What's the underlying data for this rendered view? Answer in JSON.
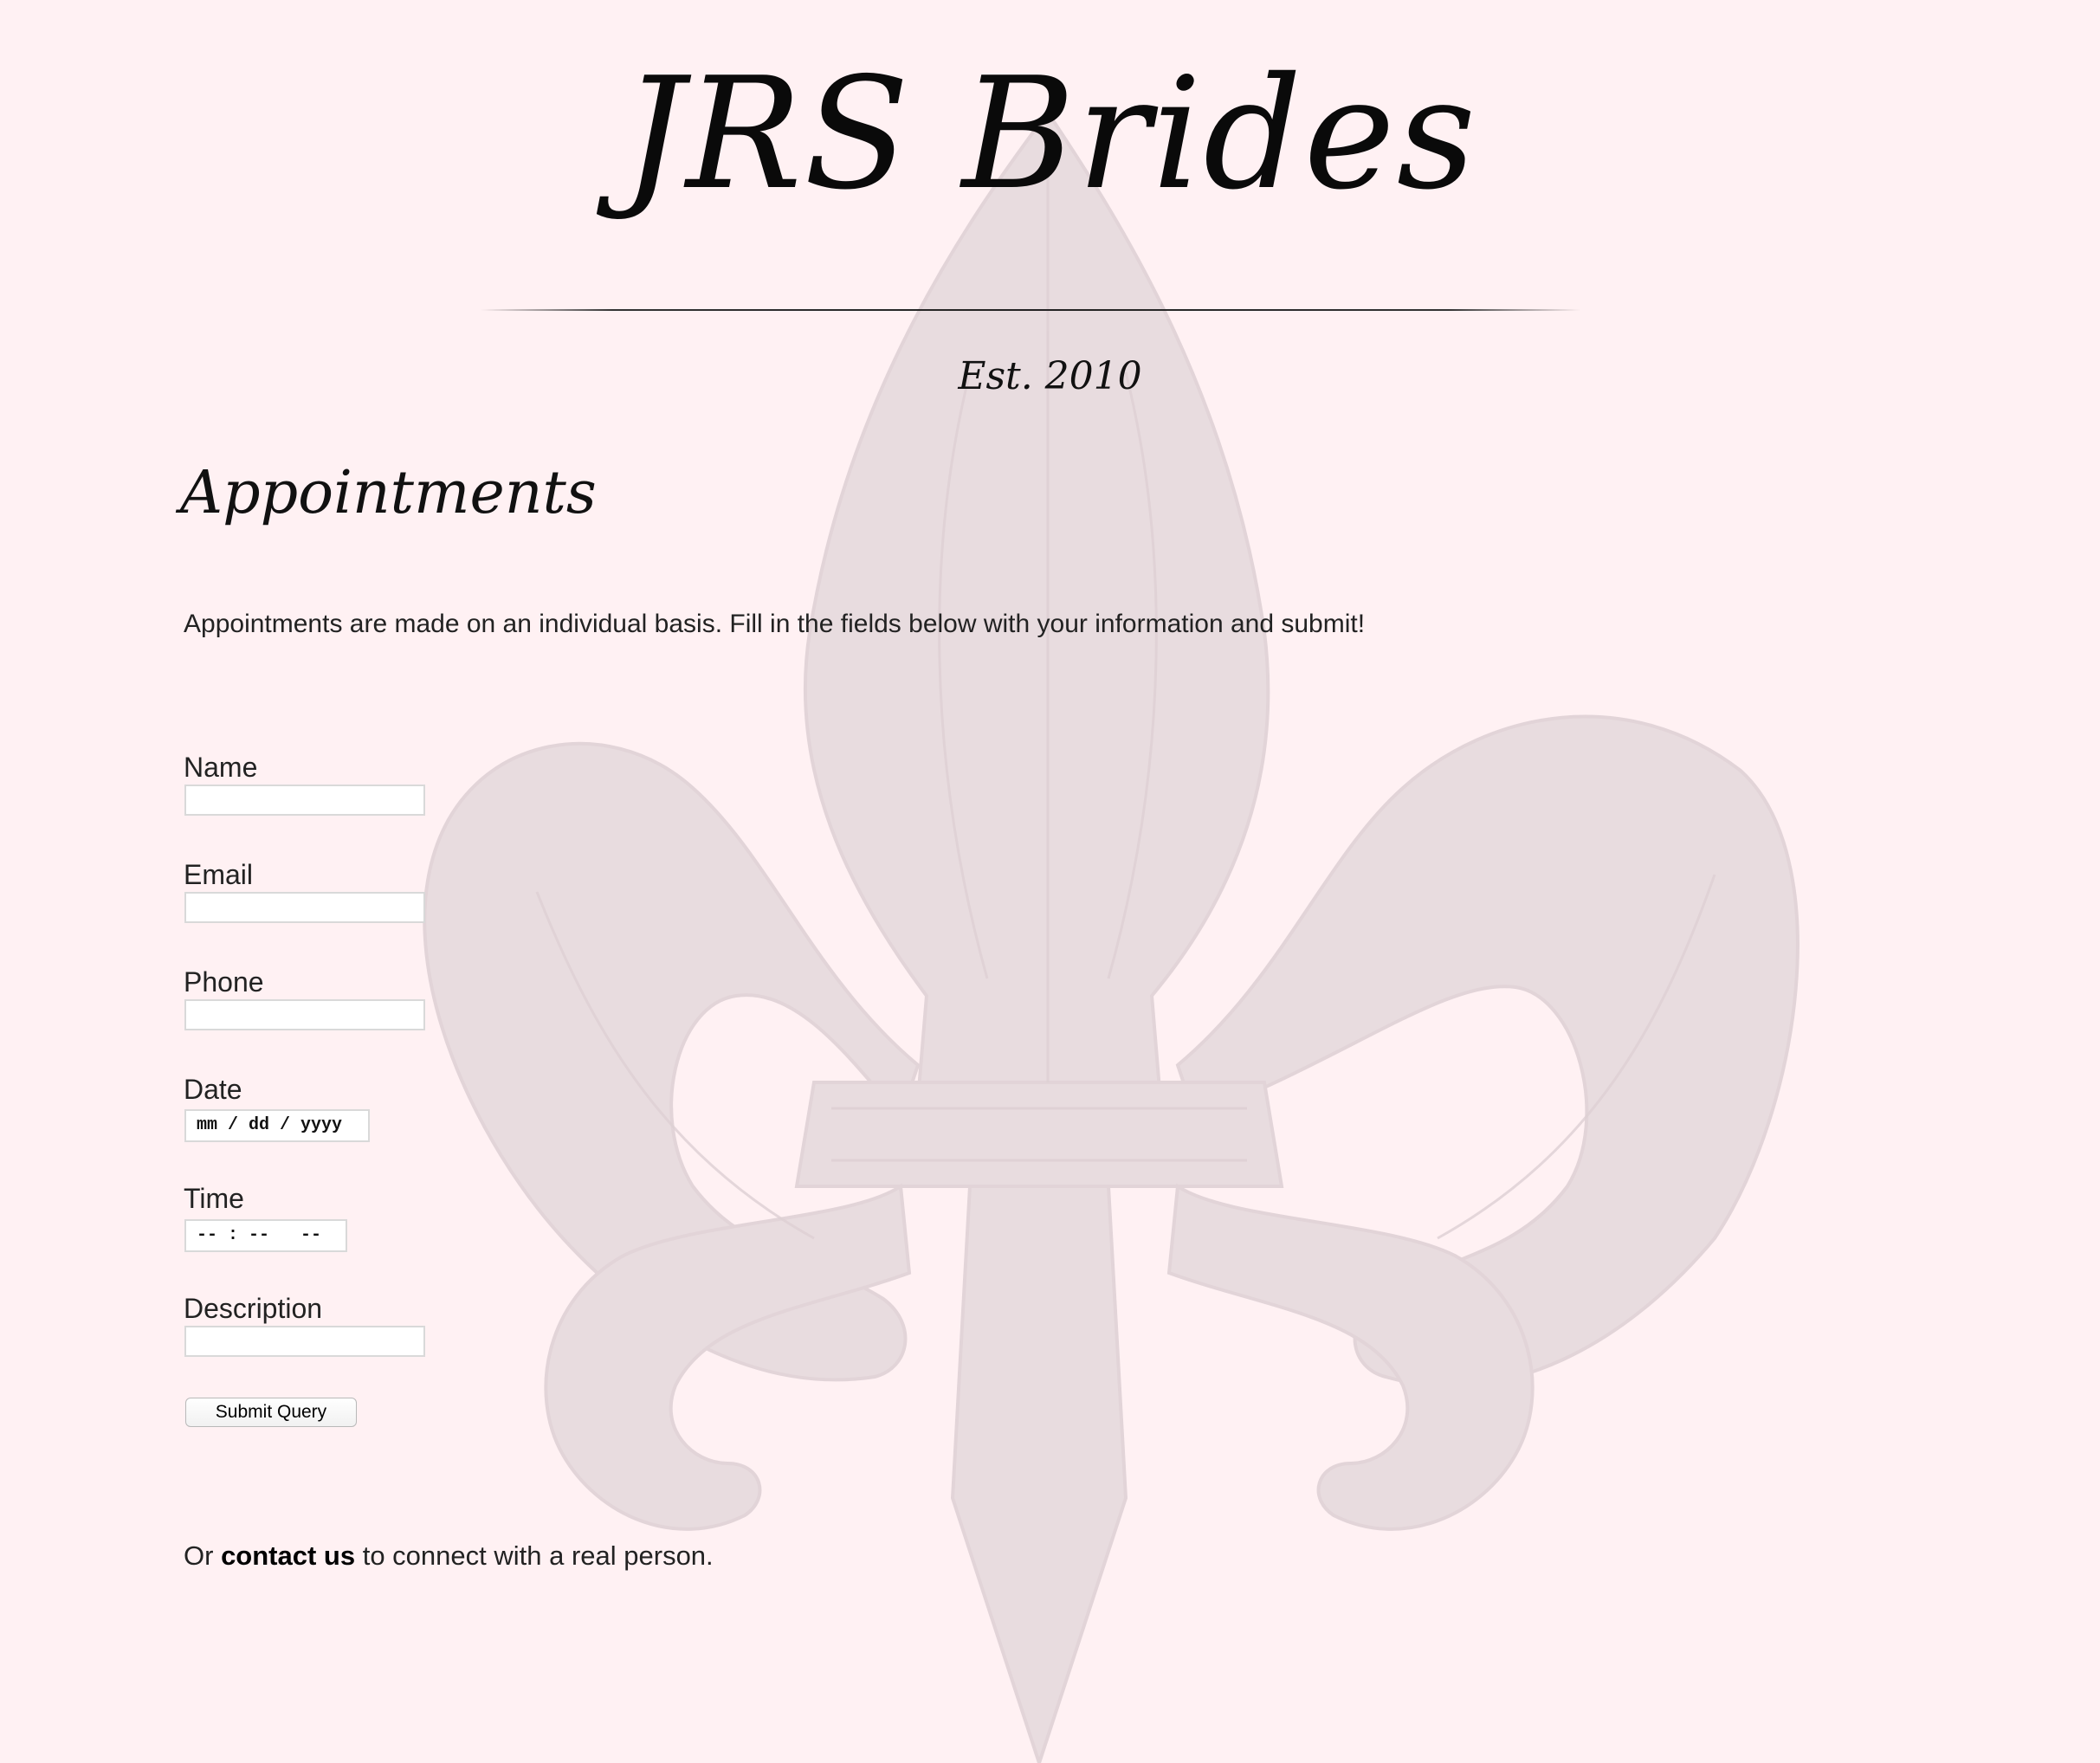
{
  "header": {
    "brand": "JRS Brides",
    "established": "Est. 2010"
  },
  "appointments": {
    "heading": "Appointments",
    "intro": "Appointments are made on an individual basis. Fill in the fields below with your information and submit!"
  },
  "form": {
    "name_label": "Name",
    "name_value": "",
    "email_label": "Email",
    "email_value": "",
    "phone_label": "Phone",
    "phone_value": "",
    "date_label": "Date",
    "date_placeholder": "mm / dd / yyyy",
    "time_label": "Time",
    "time_placeholder": "-- : --   --",
    "description_label": "Description",
    "description_value": "",
    "submit_label": "Submit Query"
  },
  "footer": {
    "prefix": "Or ",
    "link_text": "contact us",
    "suffix": " to connect with a real person."
  },
  "colors": {
    "background": "#fff1f3",
    "watermark": "#e8dcdf",
    "text": "#111111"
  },
  "icons": {
    "watermark": "fleur-de-lis-icon"
  }
}
